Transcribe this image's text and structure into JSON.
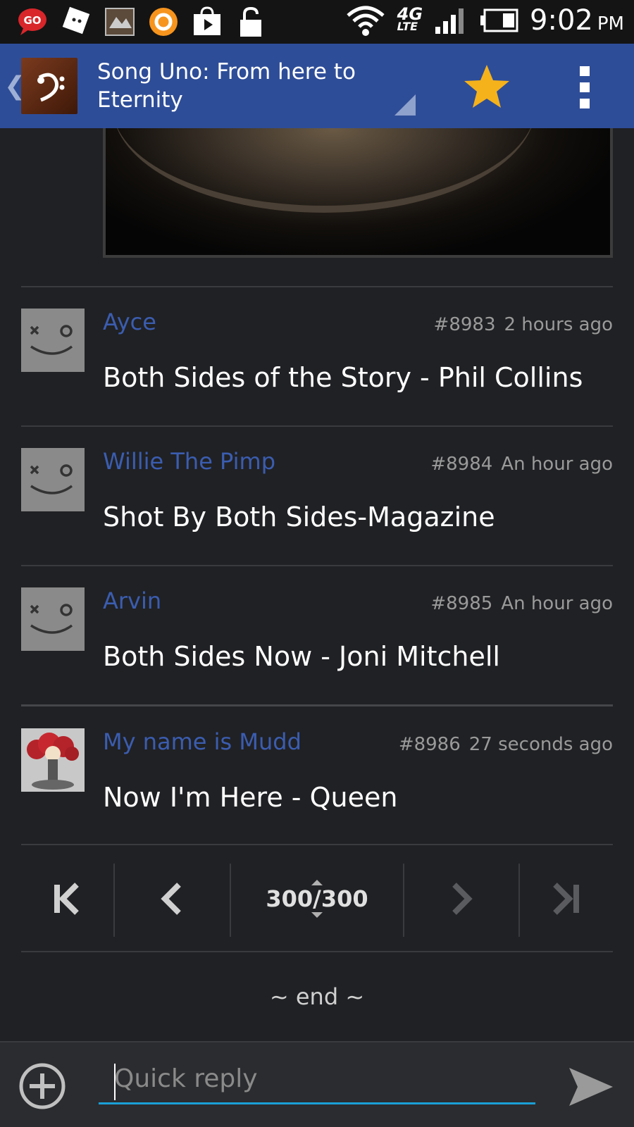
{
  "status_bar": {
    "time": "9:02",
    "ampm": "PM",
    "network": "4G",
    "network_sub": "LTE",
    "icons": [
      "go-sms-icon",
      "messenger-icon",
      "rei-icon",
      "audible-icon",
      "play-store-icon",
      "lock-icon"
    ]
  },
  "action_bar": {
    "title": "Song Uno: From here to Eternity",
    "app_icon": "bass-clef-icon",
    "accent": "#2e4d98"
  },
  "posts": [
    {
      "author": "Ayce",
      "post_no": "#8983",
      "time": "2 hours ago",
      "message": "Both Sides of the Story - Phil Collins",
      "avatar": "default-face"
    },
    {
      "author": "Willie The Pimp",
      "post_no": "#8984",
      "time": "An hour ago",
      "message": "Shot By Both Sides-Magazine",
      "avatar": "default-face"
    },
    {
      "author": "Arvin",
      "post_no": "#8985",
      "time": "An hour ago",
      "message": "Both Sides Now - Joni Mitchell",
      "avatar": "default-face"
    },
    {
      "author": "My name is Mudd",
      "post_no": "#8986",
      "time": "27 seconds ago",
      "message": "Now I'm Here - Queen",
      "avatar": "mushroom-cloud-clown"
    }
  ],
  "pager": {
    "count": "300/300",
    "current": 300,
    "total": 300
  },
  "end_text": "~ end ~",
  "reply": {
    "placeholder": "Quick reply",
    "value": ""
  },
  "colors": {
    "author_link": "#3b5db0",
    "input_underline": "#1a9fd6",
    "background": "#202124"
  }
}
